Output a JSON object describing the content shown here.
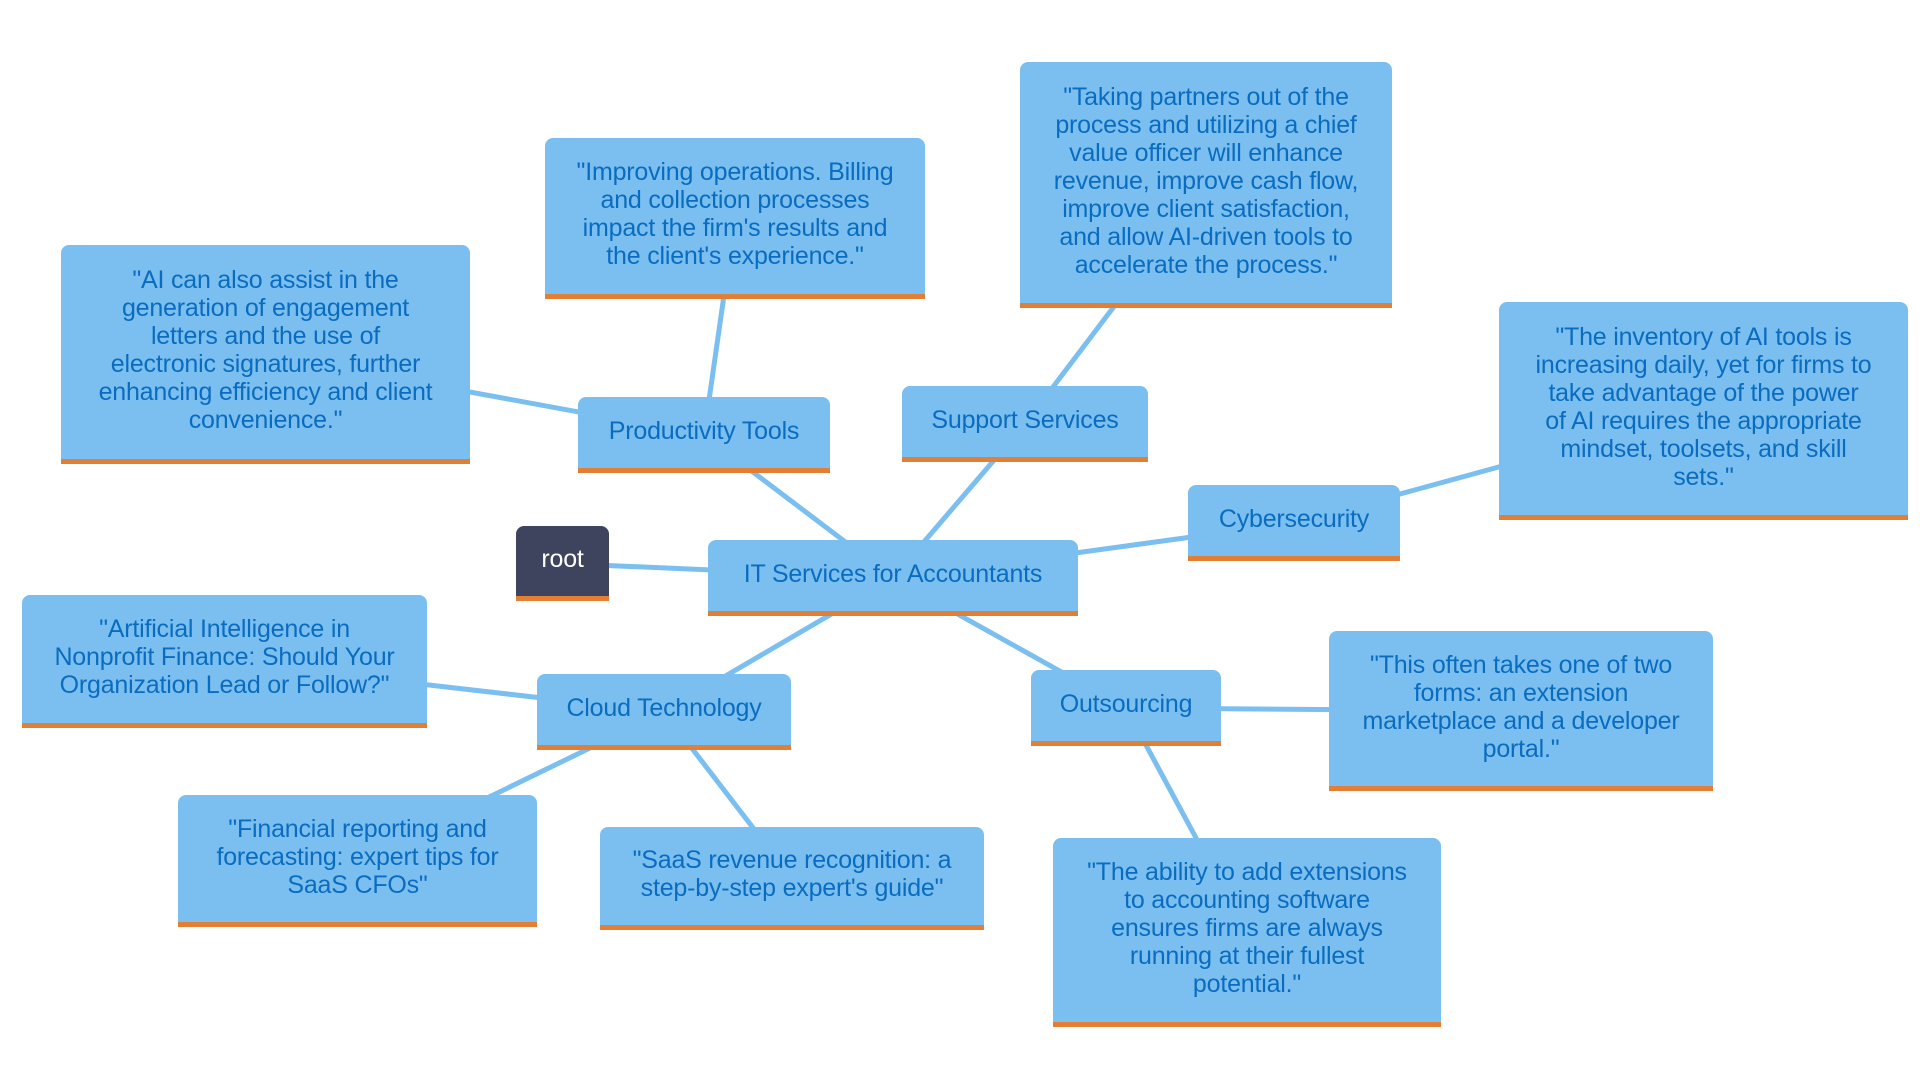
{
  "diagram": {
    "type": "mind-map",
    "colors": {
      "node_fill": "#7bbff0",
      "node_text": "#0a6cbf",
      "node_underline": "#e37f34",
      "root_fill": "#3f445e",
      "root_text": "#ffffff",
      "edge": "#7bbff0"
    },
    "nodes": {
      "root": {
        "label": "root"
      },
      "center": {
        "label": "IT Services for Accountants"
      },
      "productivity": {
        "label": "Productivity Tools"
      },
      "support": {
        "label": "Support Services"
      },
      "cyber": {
        "label": "Cybersecurity"
      },
      "cloud": {
        "label": "Cloud Technology"
      },
      "outsourcing": {
        "label": "Outsourcing"
      },
      "ai_letters": {
        "label": "\"AI can also assist in the\ngeneration of engagement\nletters and the use of\nelectronic signatures, further\nenhancing efficiency and client\nconvenience.\""
      },
      "improving": {
        "label": "\"Improving operations. Billing\nand collection processes\nimpact the firm's results and\nthe client's experience.\""
      },
      "taking": {
        "label": "\"Taking partners out of the\nprocess and utilizing a chief\nvalue officer will enhance\nrevenue, improve cash flow,\nimprove client satisfaction,\nand allow AI-driven tools to\naccelerate the process.\""
      },
      "inventory": {
        "label": "\"The inventory of AI tools is\nincreasing daily, yet for firms to\ntake advantage of the power\nof AI requires the appropriate\nmindset, toolsets, and skill\nsets.\""
      },
      "artificial": {
        "label": "\"Artificial Intelligence in\nNonprofit Finance: Should Your\nOrganization Lead or Follow?\""
      },
      "financial": {
        "label": "\"Financial reporting and\nforecasting: expert tips for\nSaaS CFOs\""
      },
      "saas": {
        "label": "\"SaaS revenue recognition: a\nstep-by-step expert's guide\""
      },
      "this_often": {
        "label": "\"This often takes one of two\nforms: an extension\nmarketplace and a developer\nportal.\""
      },
      "ability": {
        "label": "\"The ability to add extensions\nto accounting software\nensures firms are always\nrunning at their fullest\npotential.\""
      }
    },
    "edges": [
      [
        "root",
        "center"
      ],
      [
        "center",
        "productivity"
      ],
      [
        "center",
        "support"
      ],
      [
        "center",
        "cyber"
      ],
      [
        "center",
        "cloud"
      ],
      [
        "center",
        "outsourcing"
      ],
      [
        "productivity",
        "ai_letters"
      ],
      [
        "productivity",
        "improving"
      ],
      [
        "support",
        "taking"
      ],
      [
        "cyber",
        "inventory"
      ],
      [
        "cloud",
        "artificial"
      ],
      [
        "cloud",
        "financial"
      ],
      [
        "cloud",
        "saas"
      ],
      [
        "outsourcing",
        "this_often"
      ],
      [
        "outsourcing",
        "ability"
      ]
    ]
  }
}
